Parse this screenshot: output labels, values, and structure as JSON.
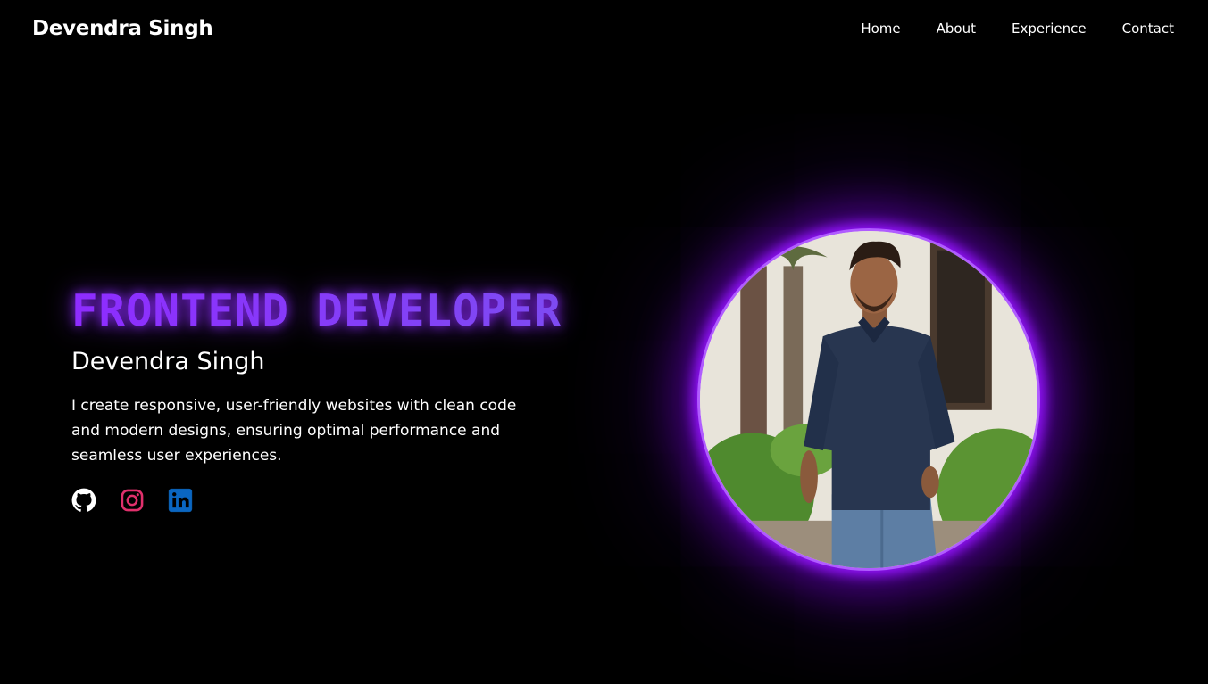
{
  "header": {
    "brand": "Devendra Singh",
    "nav": [
      {
        "label": "Home"
      },
      {
        "label": "About"
      },
      {
        "label": "Experience"
      },
      {
        "label": "Contact"
      }
    ]
  },
  "hero": {
    "role": "FRONTEND DEVELOPER",
    "name": "Devendra Singh",
    "description": "I create responsive, user-friendly websites with clean code and modern designs, ensuring optimal performance and seamless user experiences.",
    "socials": [
      {
        "icon": "github-icon"
      },
      {
        "icon": "instagram-icon"
      },
      {
        "icon": "linkedin-icon"
      }
    ],
    "photo": {
      "icon": "profile-photo"
    }
  },
  "colors": {
    "background": "#000000",
    "accent": "#8e2cff",
    "glow": "#9614ff",
    "instagram": "#e1306c",
    "linkedin": "#0a66c2"
  }
}
